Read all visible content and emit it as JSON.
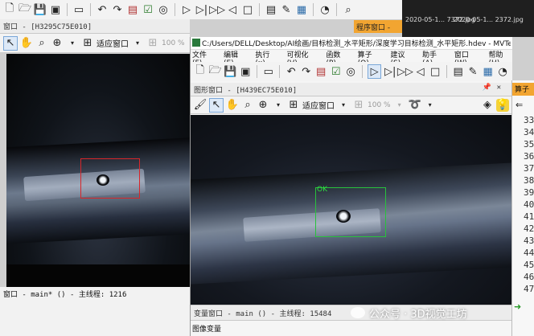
{
  "top_toolbar": {
    "icons": [
      "new-file-icon",
      "open-icon",
      "save-icon",
      "save-all-icon",
      "record-icon",
      "undo-icon",
      "redo-icon",
      "program-icon",
      "binoculars-icon",
      "run-icon",
      "step-icon",
      "step-over-icon",
      "step-back-icon",
      "stop-icon",
      "document-icon",
      "edit-icon",
      "chart-icon",
      "timer-icon",
      "search-icon"
    ]
  },
  "bg_files": {
    "file1": "2020-05-1... 7372.jpg",
    "file2": "2020-05-1... 2372.jpg"
  },
  "program_window": {
    "title": "程序窗口 -"
  },
  "left_window": {
    "title": "窗口 - [H3295C75E010]",
    "fit_select": "适应窗口",
    "zoom": "100 %",
    "status": "窗口 - main* () - 主线程: 1216"
  },
  "main_window": {
    "title": "C:/Users/DELL/Desktop/AI绘画/目标检测_水平矩形/深度学习目标检测_水平矩形.hdev - MVTec HALCON HDevelop",
    "menus": [
      "文件(F)",
      "编辑(E)",
      "执行(x)",
      "可视化(V)",
      "函数(P)",
      "算子(O)",
      "建议(S)",
      "助手(A)",
      "窗口(W)",
      "帮助(H)"
    ],
    "graphics_title": "图形窗口 - [H439EC75E010]",
    "fit_select": "适应窗口",
    "zoom": "100 %",
    "detection_label": "OK",
    "status": "变量窗口 - main () - 主线程: 15484",
    "variables_tab": "图像变量"
  },
  "right_panel": {
    "title": "算子",
    "line_numbers": [
      "33",
      "34",
      "35",
      "36",
      "37",
      "38",
      "39",
      "40",
      "41",
      "42",
      "43",
      "44",
      "45",
      "46",
      "47"
    ]
  },
  "watermark": {
    "text": "公众号 · 3D视觉工坊"
  }
}
